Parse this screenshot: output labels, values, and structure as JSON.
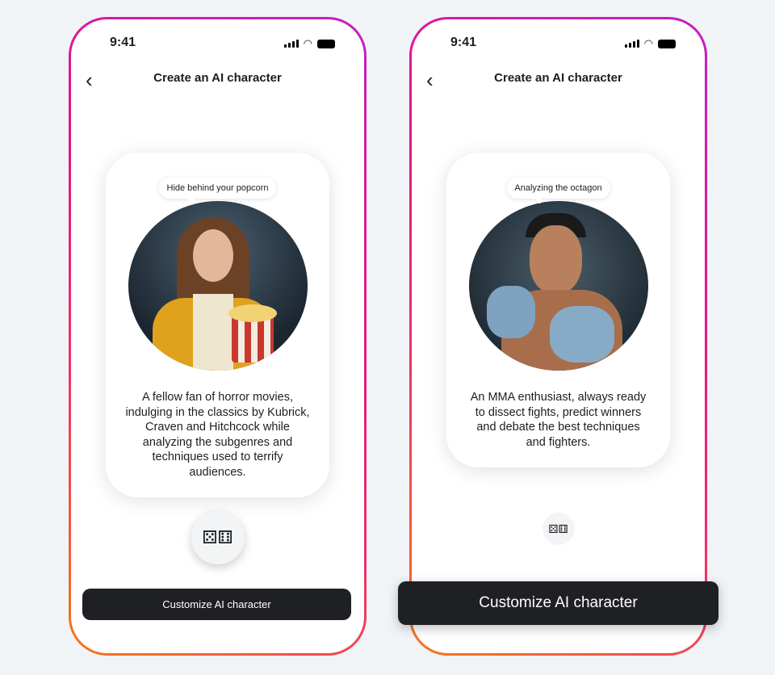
{
  "phones": [
    {
      "time": "9:41",
      "title": "Create an AI character",
      "bubble": "Hide behind your popcorn",
      "description": "A fellow fan of horror movies, indulging in the classics by Kubrick, Craven and Hitchcock while analyzing the subgenres and techniques used to terrify audiences.",
      "cta": "Customize AI character",
      "image": "woman-with-popcorn-in-hallway"
    },
    {
      "time": "9:41",
      "title": "Create an AI character",
      "bubble": "Analyzing the octagon",
      "description": "An MMA enthusiast, always ready to dissect fights, predict winners and debate the best techniques and fighters.",
      "cta": "Customize AI character",
      "image": "mma-fighter-with-gloves"
    }
  ],
  "colors": {
    "border_gradient": [
      "#c41fc6",
      "#e8157f",
      "#f5781c"
    ],
    "button": "#1f2024",
    "background": "#f1f4f7"
  }
}
